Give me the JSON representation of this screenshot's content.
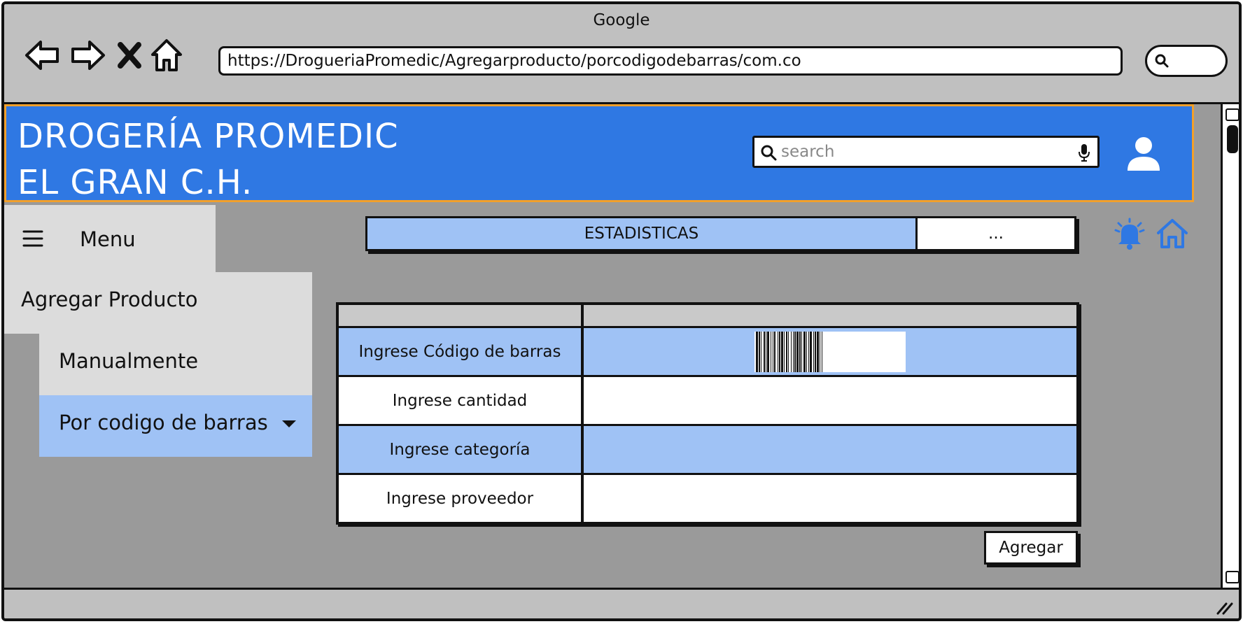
{
  "window": {
    "title": "Google"
  },
  "browser": {
    "url": "https://DrogueriaPromedic/Agregarproducto/porcodigodebarras/com.co",
    "nav_icons": [
      "back-icon",
      "forward-icon",
      "close-icon",
      "home-icon"
    ]
  },
  "header": {
    "brand_line1": "DROGERÍA PROMEDIC",
    "brand_line2": "EL GRAN C.H.",
    "search_placeholder": "search",
    "bg_color": "#2f78e3",
    "border_color": "#f2a02b"
  },
  "sidebar": {
    "menu_label": "Menu",
    "items": [
      {
        "label": "Agregar Producto"
      },
      {
        "label": "Manualmente"
      },
      {
        "label": "Por codigo de barras",
        "selected": true
      }
    ]
  },
  "tabs": [
    {
      "label": "ESTADISTICAS",
      "active": true
    },
    {
      "label": "..."
    }
  ],
  "form": {
    "rows": [
      {
        "label": "Ingrese Código de barras",
        "has_barcode": true
      },
      {
        "label": "Ingrese cantidad"
      },
      {
        "label": "Ingrese categoría"
      },
      {
        "label": "Ingrese proveedor"
      }
    ],
    "submit_label": "Agregar"
  },
  "colors": {
    "accent_light": "#9fc2f5",
    "content_bg": "#9a9a9a",
    "chrome_bg": "#c0c0c0"
  }
}
